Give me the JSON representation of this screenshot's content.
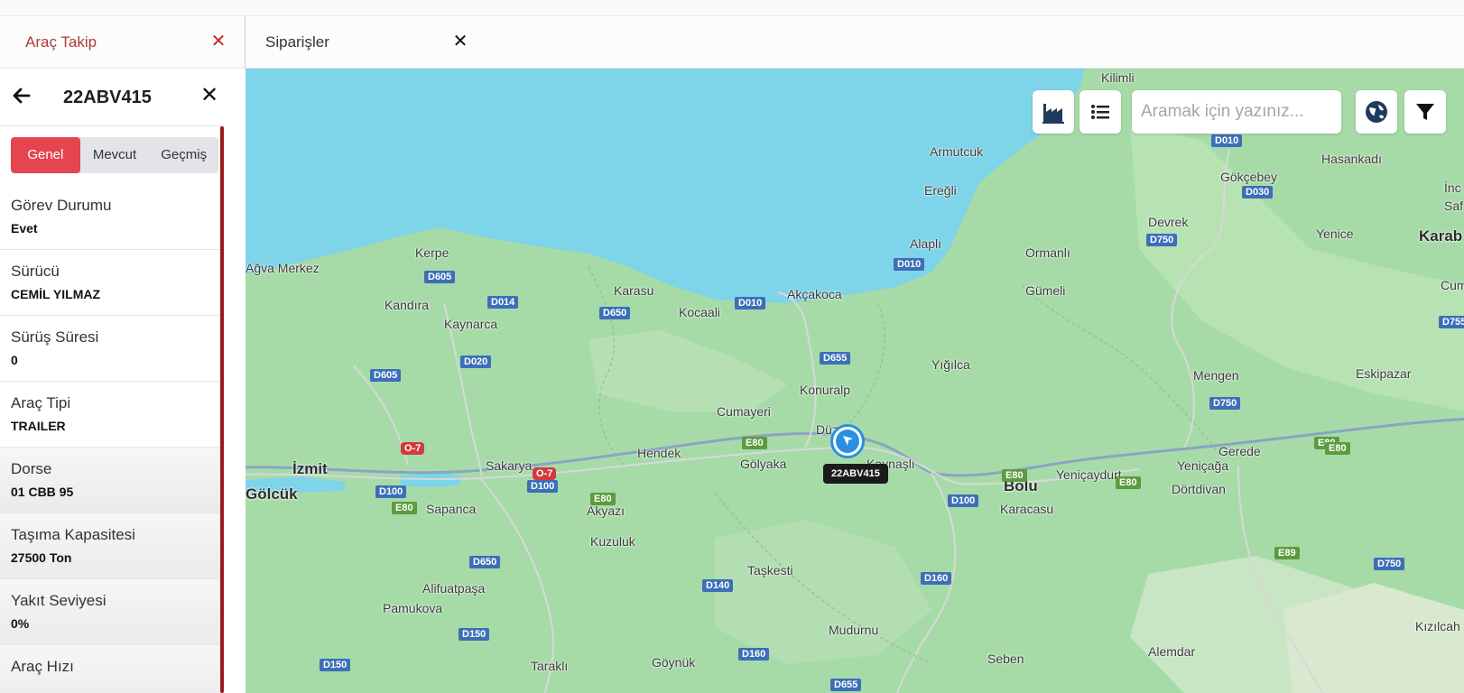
{
  "tabs": [
    {
      "label": "Araç Takip",
      "close": "✕"
    },
    {
      "label": "Siparişler",
      "close": "✕"
    }
  ],
  "panel": {
    "plate": "22ABV415",
    "close": "✕",
    "segments": [
      "Genel",
      "Mevcut",
      "Geçmiş"
    ],
    "active_segment": "Genel",
    "fields": [
      {
        "label": "Görev Durumu",
        "value": "Evet"
      },
      {
        "label": "Sürücü",
        "value": "CEMİL YILMAZ"
      },
      {
        "label": "Sürüş Süresi",
        "value": "0"
      },
      {
        "label": "Araç Tipi",
        "value": "TRAILER"
      },
      {
        "label": "Dorse",
        "value": "01 CBB 95"
      },
      {
        "label": "Taşıma Kapasitesi",
        "value": "27500 Ton"
      },
      {
        "label": "Yakıt Seviyesi",
        "value": "0%"
      },
      {
        "label": "Araç Hızı",
        "value": ""
      }
    ]
  },
  "map": {
    "search_placeholder": "Aramak için yazınız...",
    "vehicle_label": "22ABV415",
    "colors": {
      "sea": "#7ed4e8",
      "land": "#a6dba8",
      "accent": "#e4454f",
      "vehicle": "#2a8fe0"
    },
    "places": [
      {
        "name": "Kilimli"
      },
      {
        "name": "Armutcuk"
      },
      {
        "name": "Gökçebey"
      },
      {
        "name": "Hasankadı"
      },
      {
        "name": "Ereğli"
      },
      {
        "name": "Devrek"
      },
      {
        "name": "Yenice"
      },
      {
        "name": "Alaplı"
      },
      {
        "name": "Ormanlı"
      },
      {
        "name": "Kerpe"
      },
      {
        "name": "Ağva Merkez"
      },
      {
        "name": "Karasu"
      },
      {
        "name": "Akçakoca"
      },
      {
        "name": "Gümeli"
      },
      {
        "name": "Kandıra"
      },
      {
        "name": "Kaynarca"
      },
      {
        "name": "Kocaali"
      },
      {
        "name": "Yığılca"
      },
      {
        "name": "Mengen"
      },
      {
        "name": "Eskipazar"
      },
      {
        "name": "Konuralp"
      },
      {
        "name": "Cumayeri"
      },
      {
        "name": "Düzce"
      },
      {
        "name": "Hendek"
      },
      {
        "name": "Gerede"
      },
      {
        "name": "İzmit",
        "major": true
      },
      {
        "name": "Sakarya"
      },
      {
        "name": "Gölyaka"
      },
      {
        "name": "Kaynaşlı"
      },
      {
        "name": "Yeniçaydurt"
      },
      {
        "name": "Yeniçağa"
      },
      {
        "name": "Bolu",
        "major": true
      },
      {
        "name": "Gölcük",
        "major": true
      },
      {
        "name": "Dörtdivan"
      },
      {
        "name": "Sapanca"
      },
      {
        "name": "Akyazı"
      },
      {
        "name": "Karacasu"
      },
      {
        "name": "Kuzuluk"
      },
      {
        "name": "Taşkesti"
      },
      {
        "name": "Alifuatpaşa"
      },
      {
        "name": "Pamukova"
      },
      {
        "name": "Mudurnu"
      },
      {
        "name": "Seben"
      },
      {
        "name": "Alemdar"
      },
      {
        "name": "Göynük"
      },
      {
        "name": "Taraklı"
      },
      {
        "name": "Kızılcah"
      },
      {
        "name": "Karab",
        "major": true
      },
      {
        "name": "İnc"
      },
      {
        "name": "Saf"
      },
      {
        "name": "Cum"
      }
    ],
    "shields": [
      {
        "text": "D010",
        "kind": "blue"
      },
      {
        "text": "D030",
        "kind": "blue"
      },
      {
        "text": "D750",
        "kind": "blue"
      },
      {
        "text": "D010",
        "kind": "blue"
      },
      {
        "text": "D605",
        "kind": "blue"
      },
      {
        "text": "D014",
        "kind": "blue"
      },
      {
        "text": "D650",
        "kind": "blue"
      },
      {
        "text": "D010",
        "kind": "blue"
      },
      {
        "text": "D020",
        "kind": "blue"
      },
      {
        "text": "D655",
        "kind": "blue"
      },
      {
        "text": "D605",
        "kind": "blue"
      },
      {
        "text": "D750",
        "kind": "blue"
      },
      {
        "text": "E80",
        "kind": "green"
      },
      {
        "text": "O-7",
        "kind": "red"
      },
      {
        "text": "O-7",
        "kind": "red"
      },
      {
        "text": "E80",
        "kind": "green"
      },
      {
        "text": "D100",
        "kind": "blue"
      },
      {
        "text": "D100",
        "kind": "blue"
      },
      {
        "text": "E80",
        "kind": "green"
      },
      {
        "text": "E80",
        "kind": "green"
      },
      {
        "text": "E80",
        "kind": "green"
      },
      {
        "text": "D100",
        "kind": "blue"
      },
      {
        "text": "E80",
        "kind": "green"
      },
      {
        "text": "E80",
        "kind": "green"
      },
      {
        "text": "D650",
        "kind": "blue"
      },
      {
        "text": "E89",
        "kind": "green"
      },
      {
        "text": "D140",
        "kind": "blue"
      },
      {
        "text": "D160",
        "kind": "blue"
      },
      {
        "text": "D750",
        "kind": "blue"
      },
      {
        "text": "D150",
        "kind": "blue"
      },
      {
        "text": "D150",
        "kind": "blue"
      },
      {
        "text": "D160",
        "kind": "blue"
      },
      {
        "text": "D655",
        "kind": "blue"
      },
      {
        "text": "D755",
        "kind": "blue"
      }
    ]
  }
}
